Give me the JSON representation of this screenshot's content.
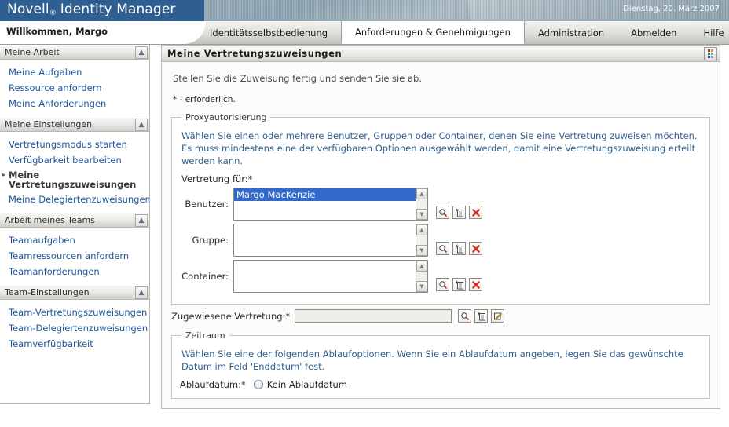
{
  "brand": {
    "product_name": "Novell",
    "registered_mark": "®",
    "suite_name": "Identity Manager",
    "date": "Dienstag, 20. März 2007"
  },
  "header": {
    "welcome": "Willkommen, Margo",
    "tabs": [
      {
        "label": "Identitätsselbstbedienung",
        "active": false
      },
      {
        "label": "Anforderungen & Genehmigungen",
        "active": true
      },
      {
        "label": "Administration",
        "active": false
      },
      {
        "label": "Abmelden",
        "active": false
      },
      {
        "label": "Hilfe",
        "active": false
      }
    ]
  },
  "sidebar": {
    "sections": [
      {
        "title": "Meine Arbeit",
        "collapse_icon": "chevron-up-double-icon",
        "items": [
          {
            "label": "Meine Aufgaben",
            "active": false
          },
          {
            "label": "Ressource anfordern",
            "active": false
          },
          {
            "label": "Meine Anforderungen",
            "active": false
          }
        ]
      },
      {
        "title": "Meine Einstellungen",
        "collapse_icon": "chevron-up-double-icon",
        "items": [
          {
            "label": "Vertretungsmodus starten",
            "active": false
          },
          {
            "label": "Verfügbarkeit bearbeiten",
            "active": false
          },
          {
            "label": "Meine Vertretungszuweisungen",
            "active": true
          },
          {
            "label": "Meine Delegiertenzuweisungen",
            "active": false
          }
        ]
      },
      {
        "title": "Arbeit meines Teams",
        "collapse_icon": "chevron-up-double-icon",
        "items": [
          {
            "label": "Teamaufgaben",
            "active": false
          },
          {
            "label": "Teamressourcen anfordern",
            "active": false
          },
          {
            "label": "Teamanforderungen",
            "active": false
          }
        ]
      },
      {
        "title": "Team-Einstellungen",
        "collapse_icon": "chevron-up-double-icon",
        "items": [
          {
            "label": "Team-Vertretungszuweisungen",
            "active": false
          },
          {
            "label": "Team-Delegiertenzuweisungen",
            "active": false
          },
          {
            "label": "Teamverfügbarkeit",
            "active": false
          }
        ]
      }
    ]
  },
  "panel": {
    "title": "Meine Vertretungszuweisungen",
    "grid_icon": "color-grid-icon",
    "intro": "Stellen Sie die Zuweisung fertig und senden Sie sie ab.",
    "required_note": "* - erforderlich."
  },
  "proxy_section": {
    "legend": "Proxyautorisierung",
    "help": "Wählen Sie einen oder mehrere Benutzer, Gruppen oder Container, denen Sie eine Vertretung zuweisen möchten. Es muss mindestens eine der verfügbaren Optionen ausgewählt werden, damit eine Vertretungszuweisung erteilt werden kann.",
    "proxy_for_label": "Vertretung für:*",
    "rows": [
      {
        "label": "Benutzer:",
        "selected_value": "Margo MacKenzie",
        "icons": [
          "search-icon",
          "add-entry-icon",
          "remove-icon"
        ]
      },
      {
        "label": "Gruppe:",
        "selected_value": "",
        "icons": [
          "search-icon",
          "add-entry-icon",
          "remove-icon"
        ]
      },
      {
        "label": "Container:",
        "selected_value": "",
        "icons": [
          "search-icon",
          "add-entry-icon",
          "remove-icon"
        ]
      }
    ],
    "assigned": {
      "label": "Zugewiesene Vertretung:*",
      "value": "",
      "placeholder": "",
      "icons": [
        "search-icon",
        "add-entry-icon",
        "edit-icon"
      ]
    }
  },
  "period_section": {
    "legend": "Zeitraum",
    "help": "Wählen Sie eine der folgenden Ablaufoptionen. Wenn Sie ein Ablaufdatum angeben, legen Sie das gewünschte Datum im Feld 'Enddatum' fest.",
    "expiry_label": "Ablaufdatum:*",
    "options": [
      {
        "label": "Kein Ablaufdatum",
        "selected": true
      }
    ]
  },
  "colors": {
    "brand_blue": "#2f5f91",
    "link_blue": "#1e5799",
    "help_blue": "#2f6192",
    "selection_blue": "#3369c8",
    "delete_red": "#d42b1e"
  }
}
